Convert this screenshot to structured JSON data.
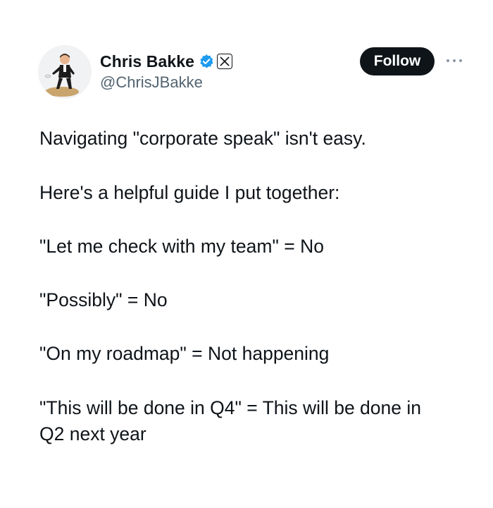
{
  "author": {
    "display_name": "Chris Bakke",
    "handle": "@ChrisJBakke",
    "verified": true,
    "affiliate_badge": "x-logo-icon"
  },
  "actions": {
    "follow_label": "Follow",
    "more_icon": "more-dots-icon"
  },
  "tweet": {
    "lines": [
      "Navigating \"corporate speak\" isn't easy.",
      "Here's a helpful guide I put together:",
      "\"Let me check with my team\" = No",
      "\"Possibly\" = No",
      "\"On my roadmap\" = Not happening",
      "\"This will be done in Q4\" = This will be done in",
      "Q2 next year"
    ]
  },
  "colors": {
    "text": "#0f1419",
    "secondary": "#536471",
    "verified_blue": "#1d9bf0",
    "button_bg": "#0f1419"
  }
}
